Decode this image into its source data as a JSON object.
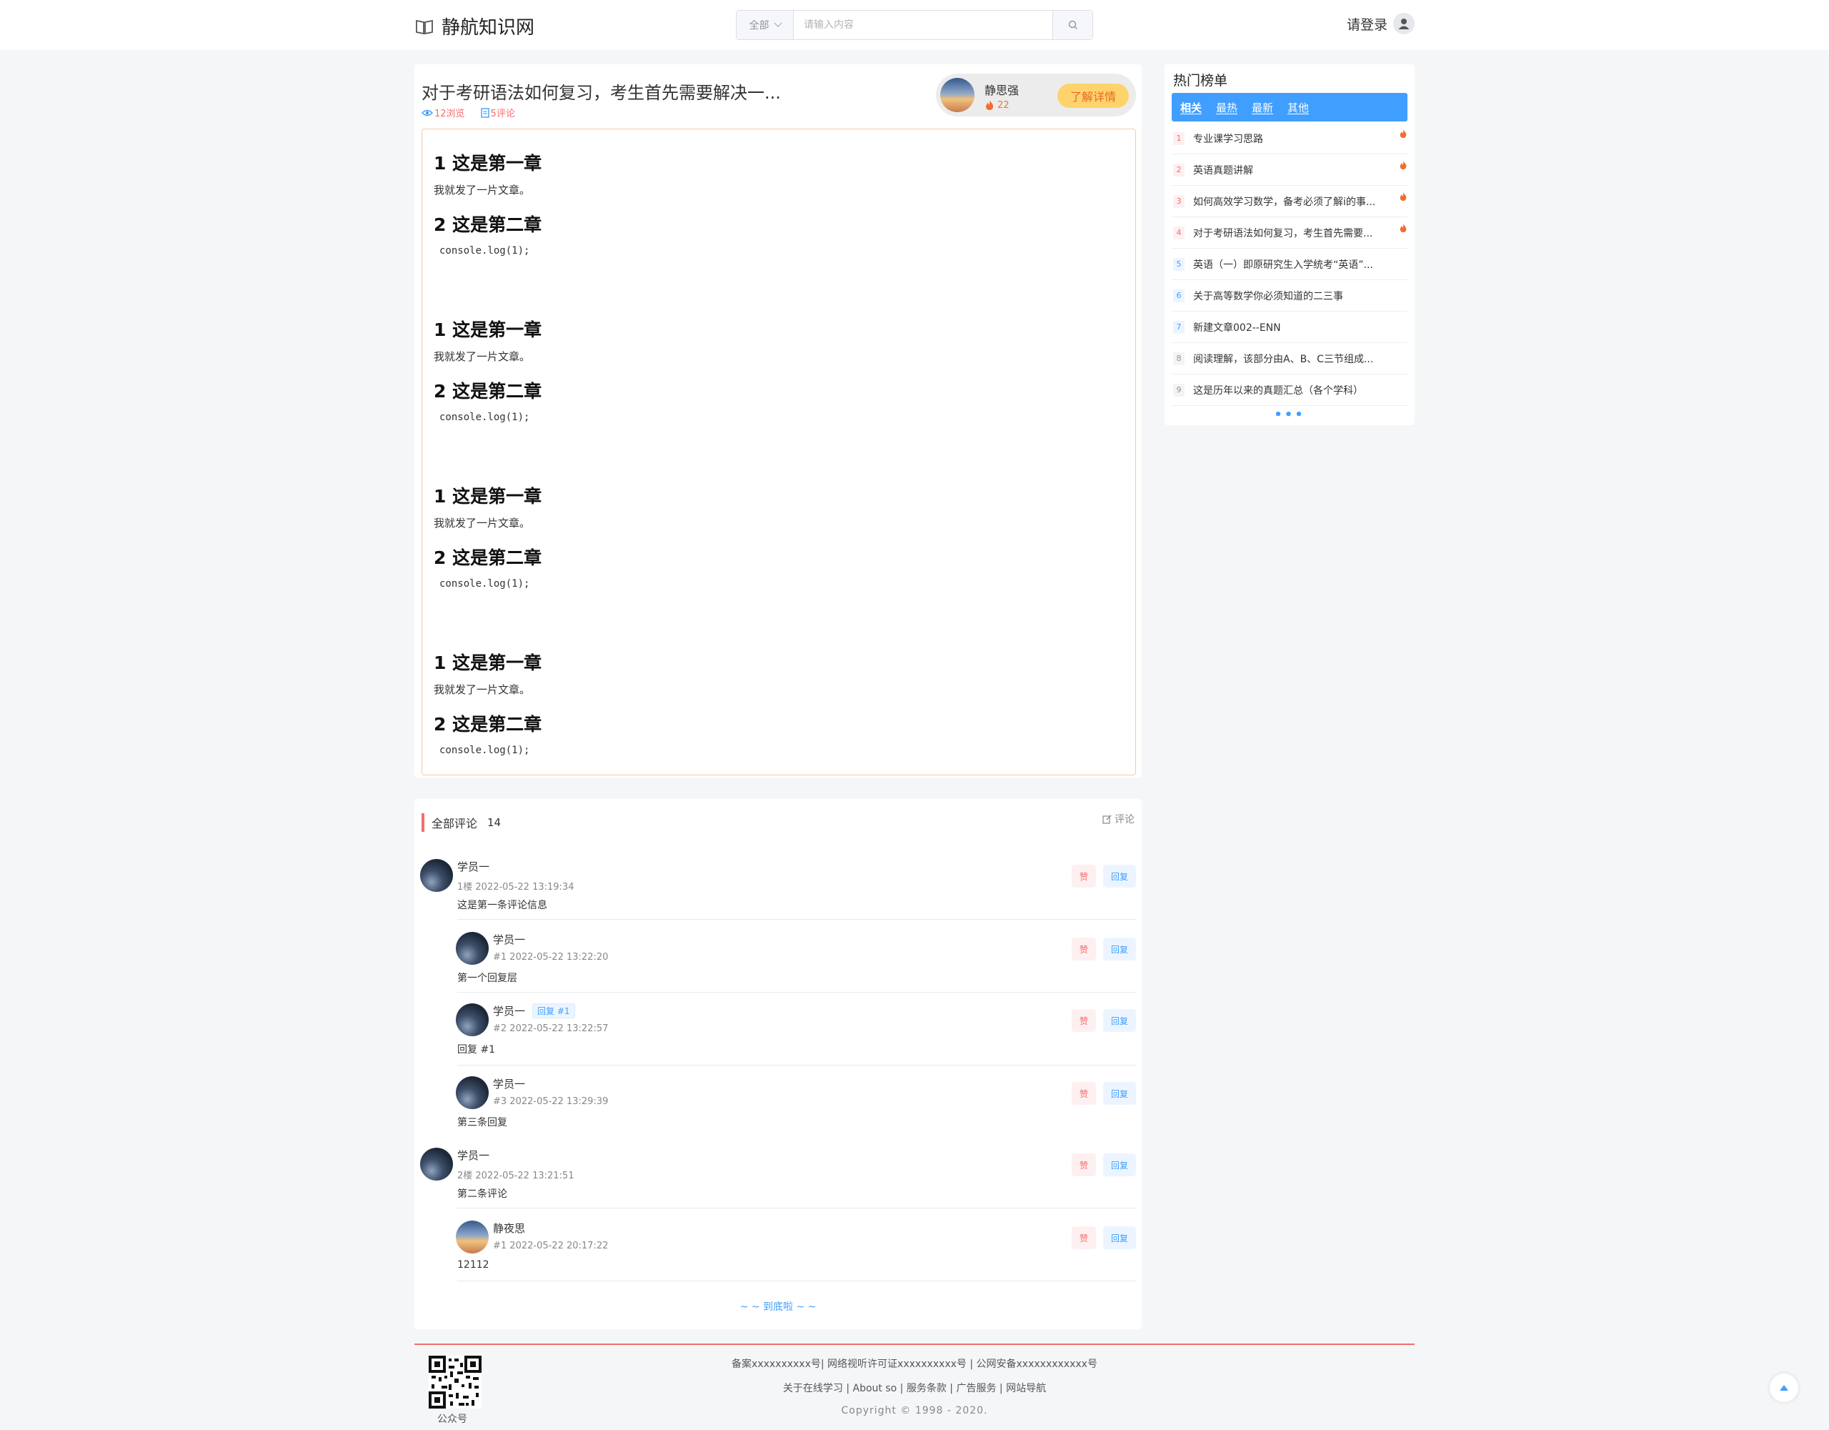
{
  "header": {
    "site_name": "静航知识网",
    "search_scope": "全部",
    "search_placeholder": "请输入内容",
    "login_label": "请登录"
  },
  "article": {
    "title": "对于考研语法如何复习，考生首先需要解决一...",
    "views": "12浏览",
    "comments": "5评论",
    "author": {
      "name": "静思强",
      "hot": "22",
      "detail_button": "了解详情"
    },
    "sections": [
      {
        "h1": "1 这是第一章",
        "text": "我就发了一片文章。",
        "h2": "2 这是第二章",
        "code": "console.log(1);"
      },
      {
        "h1": "1 这是第一章",
        "text": "我就发了一片文章。",
        "h2": "2 这是第二章",
        "code": "console.log(1);"
      },
      {
        "h1": "1 这是第一章",
        "text": "我就发了一片文章。",
        "h2": "2 这是第二章",
        "code": "console.log(1);"
      },
      {
        "h1": "1 这是第一章",
        "text": "我就发了一片文章。",
        "h2": "2 这是第二章",
        "code": "console.log(1);"
      }
    ]
  },
  "comments": {
    "title": "全部评论",
    "count": "14",
    "write_label": "评论",
    "like_label": "赞",
    "reply_label": "回复",
    "end_text": "~ ~ 到底啦 ~ ~",
    "items": [
      {
        "name": "学员一",
        "time": "1楼 2022-05-22 13:19:34",
        "body": "这是第一条评论信息",
        "tag": ""
      },
      {
        "name": "学员一",
        "time": "#1   2022-05-22 13:22:20",
        "body": "第一个回复层",
        "tag": ""
      },
      {
        "name": "学员一",
        "time": "#2   2022-05-22 13:22:57",
        "body": "回复 #1",
        "tag": "回复 #1"
      },
      {
        "name": "学员一",
        "time": "#3   2022-05-22 13:29:39",
        "body": "第三条回复",
        "tag": ""
      },
      {
        "name": "学员一",
        "time": "2楼 2022-05-22 13:21:51",
        "body": "第二条评论",
        "tag": ""
      },
      {
        "name": "静夜思",
        "time": "#1   2022-05-22 20:17:22",
        "body": "12112",
        "tag": ""
      }
    ]
  },
  "hot": {
    "title": "热门榜单",
    "tabs": [
      "相关",
      "最热",
      "最新",
      "其他"
    ],
    "items": [
      {
        "num": "1",
        "text": "专业课学习思路"
      },
      {
        "num": "2",
        "text": "英语真题讲解"
      },
      {
        "num": "3",
        "text": "如何高效学习数学，备考必须了解i的事..."
      },
      {
        "num": "4",
        "text": "对于考研语法如何复习，考生首先需要..."
      },
      {
        "num": "5",
        "text": "英语（一）即原研究生入学统考“英语”..."
      },
      {
        "num": "6",
        "text": "关于高等数学你必须知道的二三事"
      },
      {
        "num": "7",
        "text": "新建文章002--ENN"
      },
      {
        "num": "8",
        "text": "阅读理解，该部分由A、B、C三节组成..."
      },
      {
        "num": "9",
        "text": "这是历年以来的真题汇总（各个学科）"
      }
    ],
    "more": "•••"
  },
  "footer": {
    "line1": "备案xxxxxxxxxx号| 网络视听许可证xxxxxxxxxx号 | 公网安备xxxxxxxxxxxx号",
    "line2": "关于在线学习 | About so | 服务条款 | 广告服务 | 网站导航",
    "line3": "Copyright © 1998 - 2020.",
    "qr_label": "公众号"
  },
  "colors": {
    "accent": "#409eff",
    "danger": "#f56c6c",
    "detail_button": "#ffd36b"
  }
}
